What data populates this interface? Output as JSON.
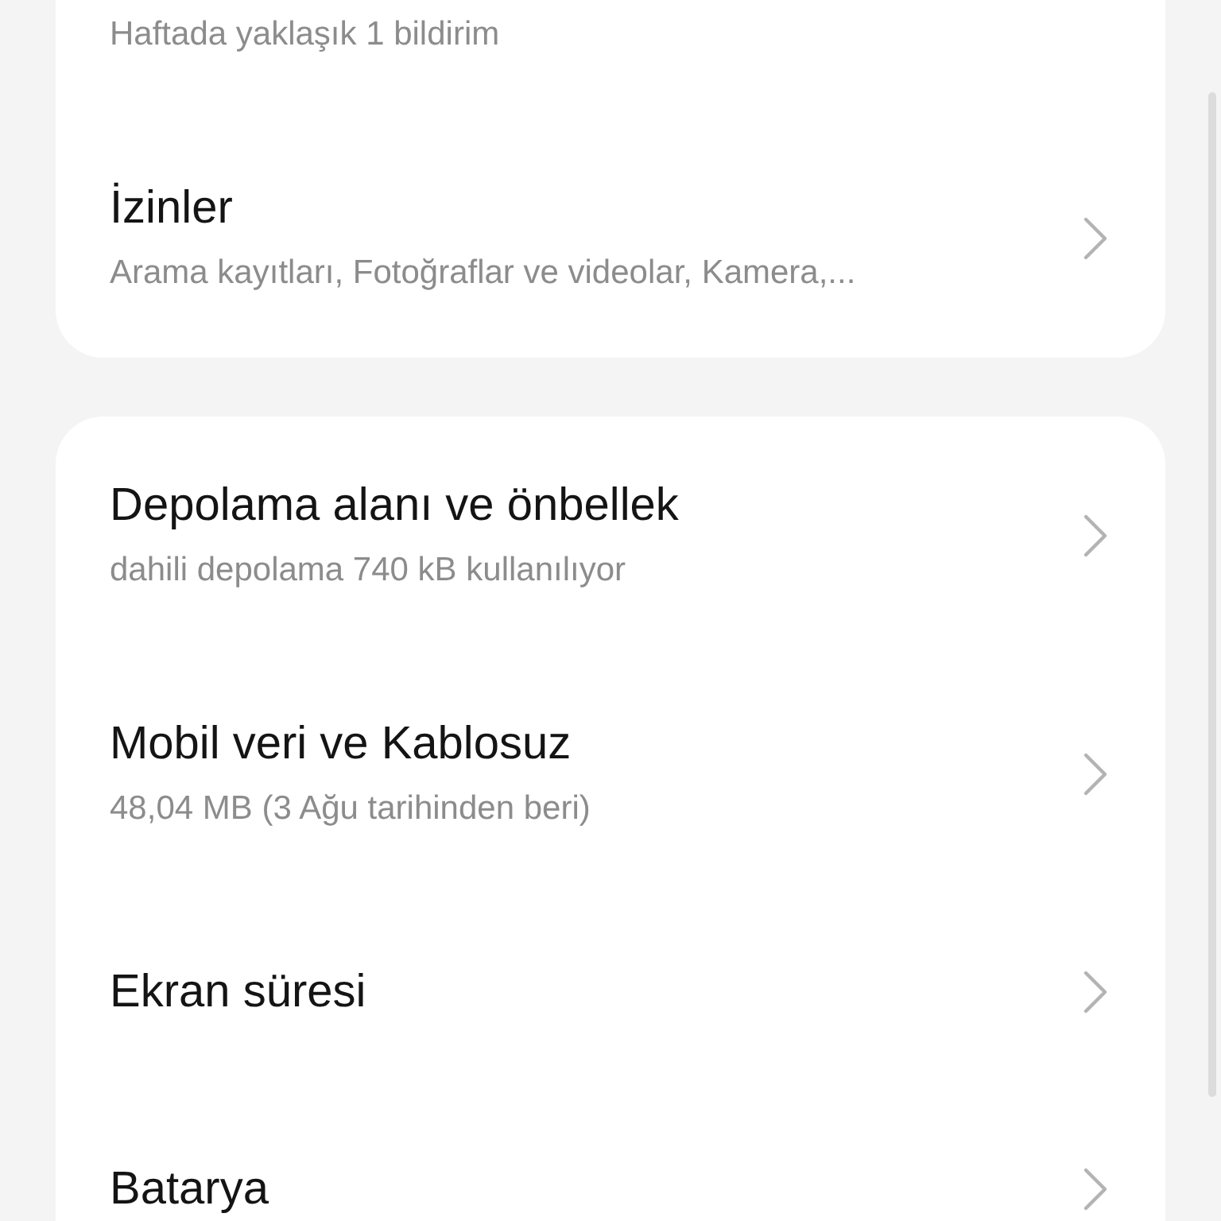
{
  "sections": [
    {
      "items": [
        {
          "subtitle": "Haftada yaklaşık 1 bildirim"
        },
        {
          "title": "İzinler",
          "subtitle": "Arama kayıtları, Fotoğraflar ve videolar, Kamera,..."
        }
      ]
    },
    {
      "items": [
        {
          "title": "Depolama alanı ve önbellek",
          "subtitle": "dahili depolama 740 kB kullanılıyor"
        },
        {
          "title": "Mobil veri ve Kablosuz",
          "subtitle": "48,04 MB (3 Ağu tarihinden beri)"
        },
        {
          "title": "Ekran süresi"
        },
        {
          "title": "Batarya"
        }
      ]
    }
  ]
}
